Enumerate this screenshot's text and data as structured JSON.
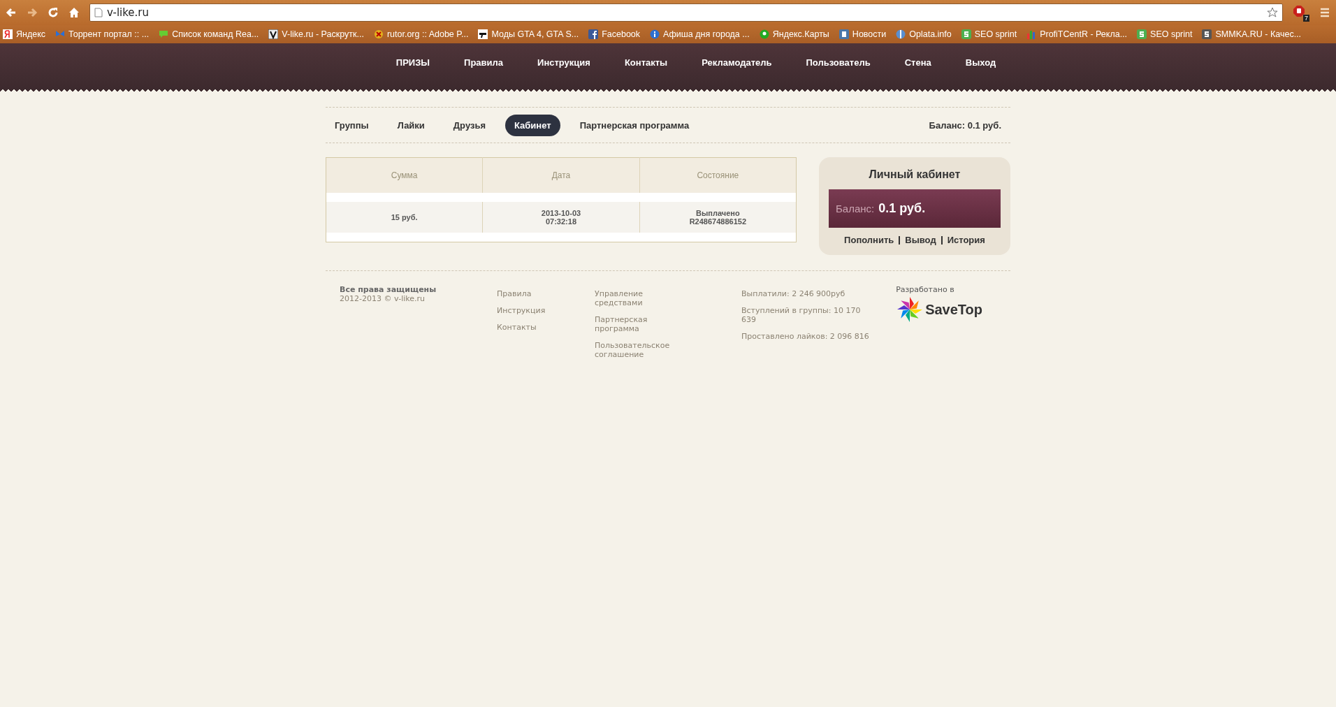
{
  "browser": {
    "url": "v-like.ru",
    "extension_badge": "7",
    "bookmarks": [
      "Яндекс",
      "Торрент портал :: ...",
      "Список команд Rea...",
      "V-like.ru - Раскрутк...",
      "rutor.org :: Adobe P...",
      "Моды GTA 4, GTA S...",
      "Facebook",
      "Афиша дня города ...",
      "Яндекс.Карты",
      "Новости",
      "Oplata.info",
      "SEO sprint",
      "ProfiTCentR - Рекла...",
      "SEO sprint",
      "SMMKA.RU - Качес..."
    ]
  },
  "nav": [
    "ПРИЗЫ",
    "Правила",
    "Инструкция",
    "Контакты",
    "Рекламодатель",
    "Пользователь",
    "Стена",
    "Выход"
  ],
  "tabs": [
    {
      "label": "Группы",
      "selected": false
    },
    {
      "label": "Лайки",
      "selected": false
    },
    {
      "label": "Друзья",
      "selected": false
    },
    {
      "label": "Кабинет",
      "selected": true
    },
    {
      "label": "Партнерская программа",
      "selected": false
    }
  ],
  "balance_top": "Баланс: 0.1 руб.",
  "table": {
    "columns": [
      "Сумма",
      "Дата",
      "Состояние"
    ],
    "rows": [
      [
        "15 руб.",
        "2013-10-03 07:32:18",
        "Выплачено R248674886152"
      ]
    ]
  },
  "cabinet": {
    "title": "Личный кабинет",
    "balance_label": "Баланс:",
    "balance_value": "0.1 руб.",
    "links": [
      "Пополнить",
      "Вывод",
      "История"
    ]
  },
  "footer": {
    "rights": "Все права защищены",
    "copyright": "2012-2013 © v-like.ru",
    "links_1": [
      "Правила",
      "Инструкция",
      "Контакты"
    ],
    "links_2": [
      "Управление средствами",
      "Партнерская программа",
      "Пользовательское соглашение"
    ],
    "stats": [
      "Выплатили: 2 246 900руб",
      "Вступлений в группы: 10 170 639",
      "Проставлено лайков: 2 096 816"
    ],
    "developed_by": "Разработано в",
    "logo_text": "SaveTop"
  }
}
